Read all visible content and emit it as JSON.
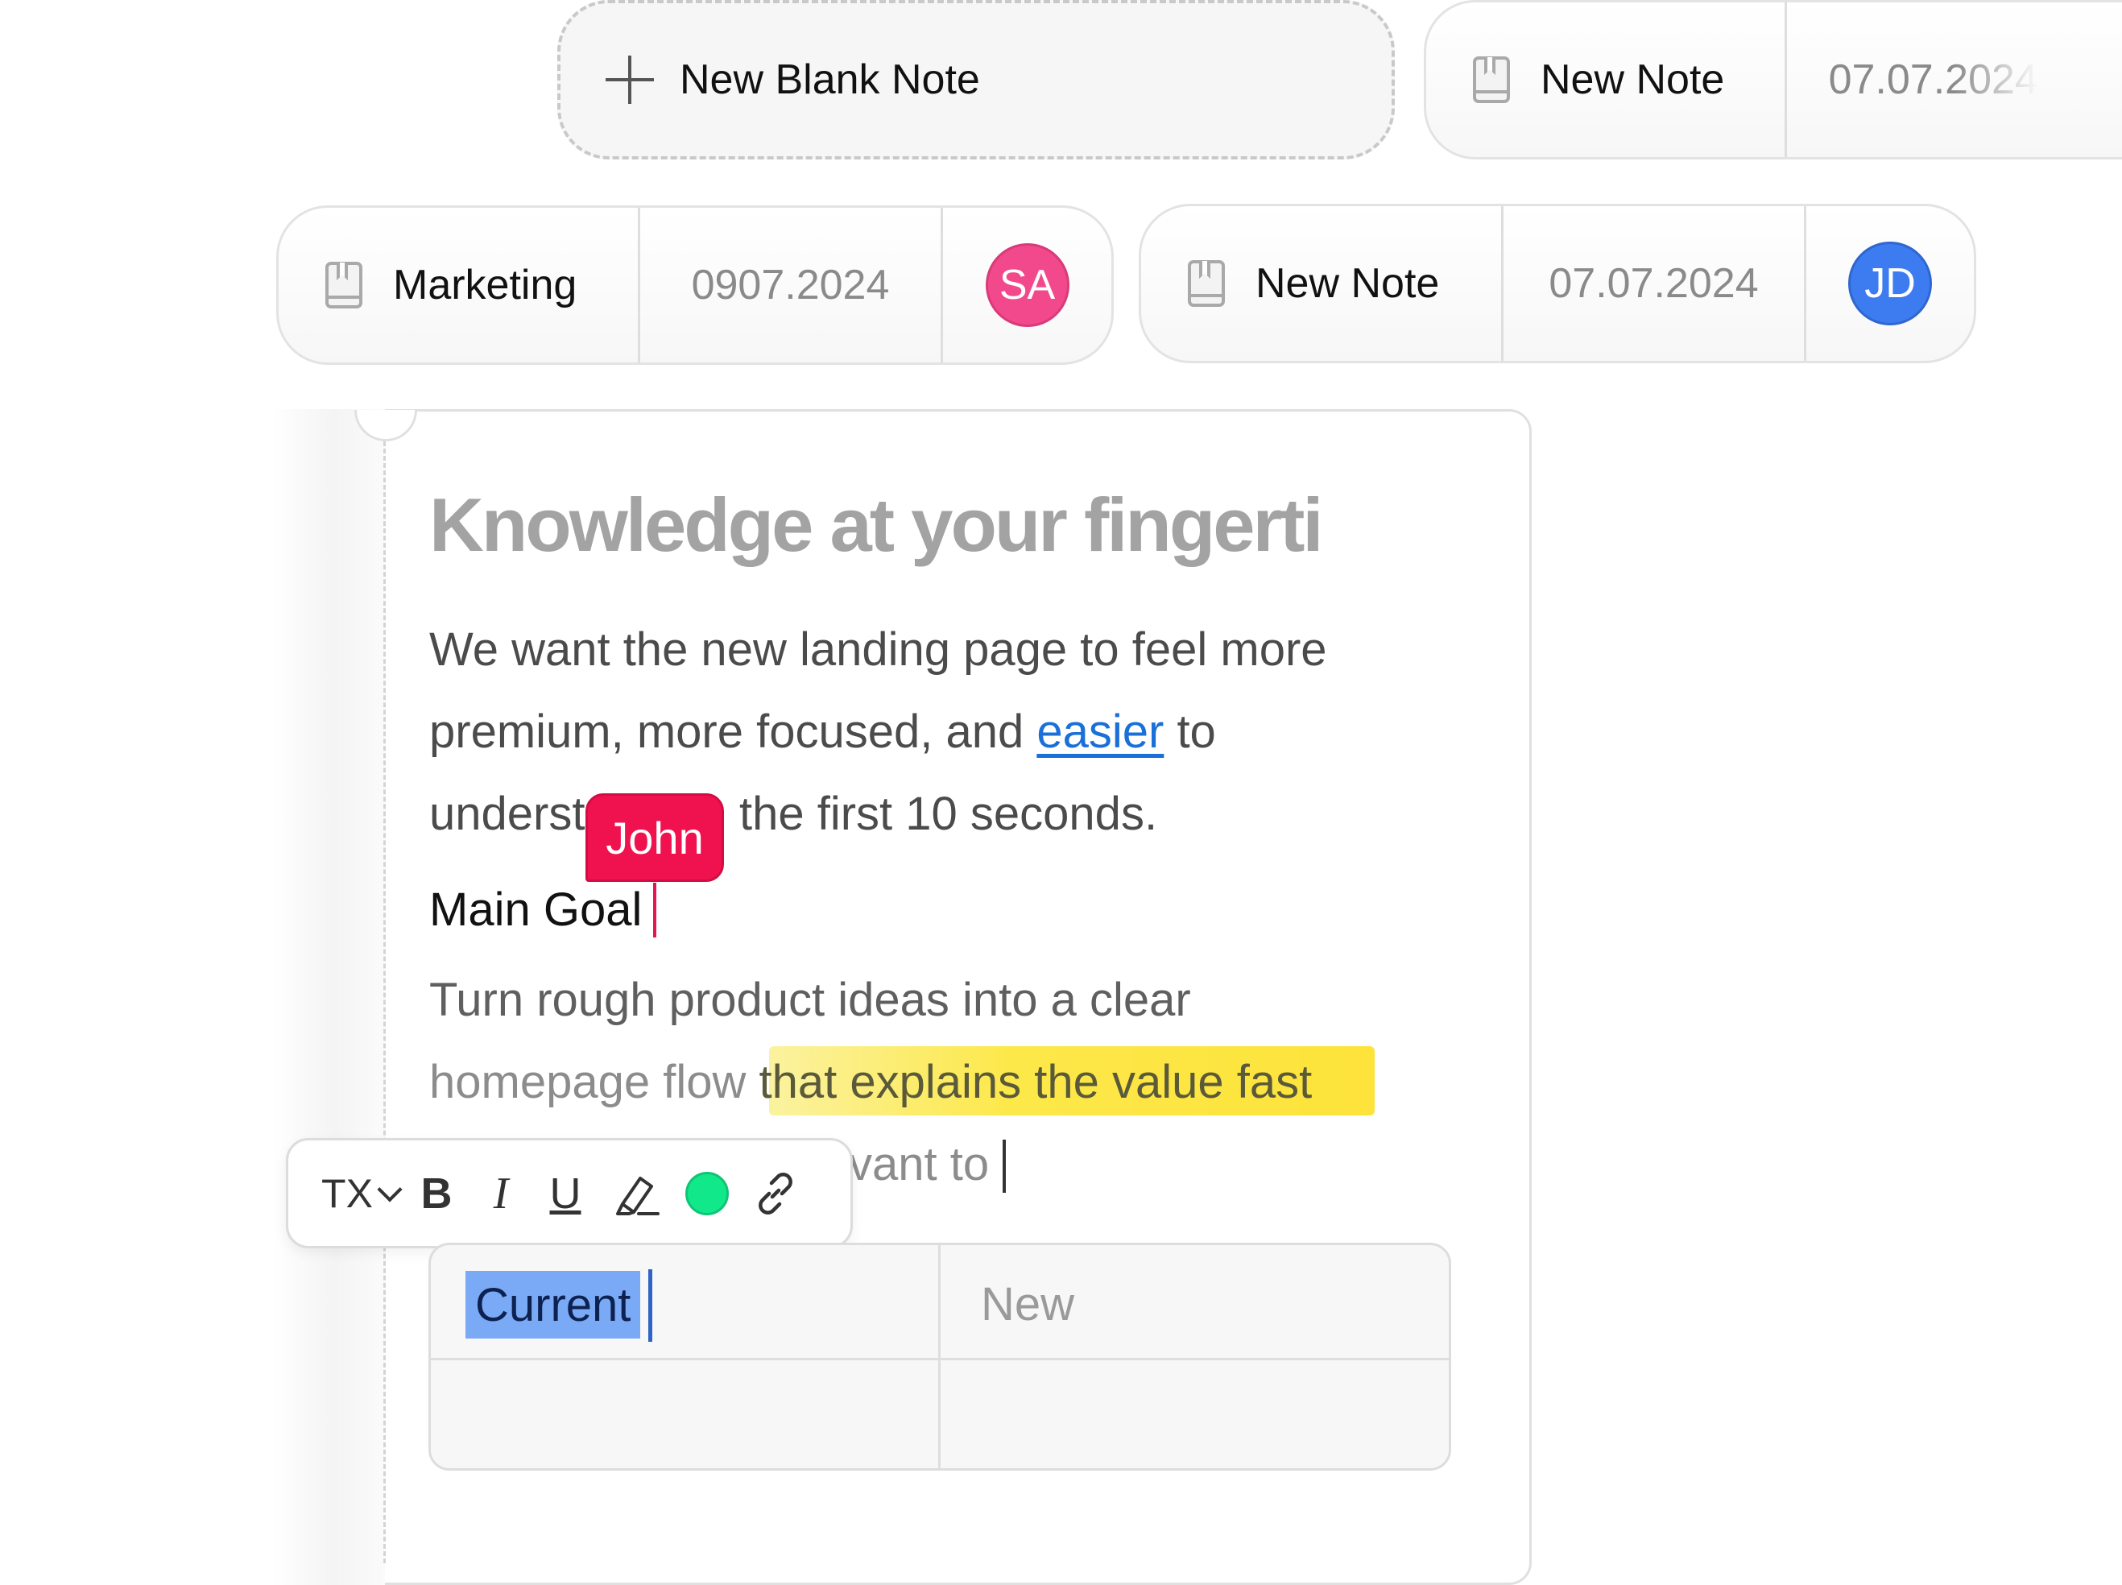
{
  "top_row": {
    "blank_note_label": "New Blank Note",
    "note_card": {
      "title": "New Note",
      "date": "07.07.2024"
    }
  },
  "second_row": [
    {
      "title": "Marketing",
      "date": "0907.2024",
      "avatar_initials": "SA",
      "avatar_color": "#f2498c"
    },
    {
      "title": "New Note",
      "date": "07.07.2024",
      "avatar_initials": "JD",
      "avatar_color": "#3d7cf0"
    }
  ],
  "editor": {
    "title": "Knowledge at your fingerti",
    "para1_line1": "We want the new landing page to feel more",
    "para1_line2_pre": "premium, more focused, and ",
    "para1_line2_link": "easier",
    "para1_line2_post": " to",
    "para1_line3_pre": "underst",
    "para1_line3_post": "the first 10 seconds.",
    "collaborator_cursor": "John",
    "heading": "Main Goal",
    "para2_line1": "Turn rough product ideas into a clear",
    "para2_line2_pre": "homepage flow ",
    "para2_line2_highlight": "that explains the value fast",
    "para2_line3_visible": "vant to"
  },
  "toolbar": {
    "text_style": "TX",
    "bold": "B",
    "italic": "I",
    "underline": "U",
    "color_swatch": "#11e88a"
  },
  "table": {
    "headers": [
      "Current",
      "New"
    ],
    "rows": [
      [
        "",
        ""
      ]
    ]
  }
}
